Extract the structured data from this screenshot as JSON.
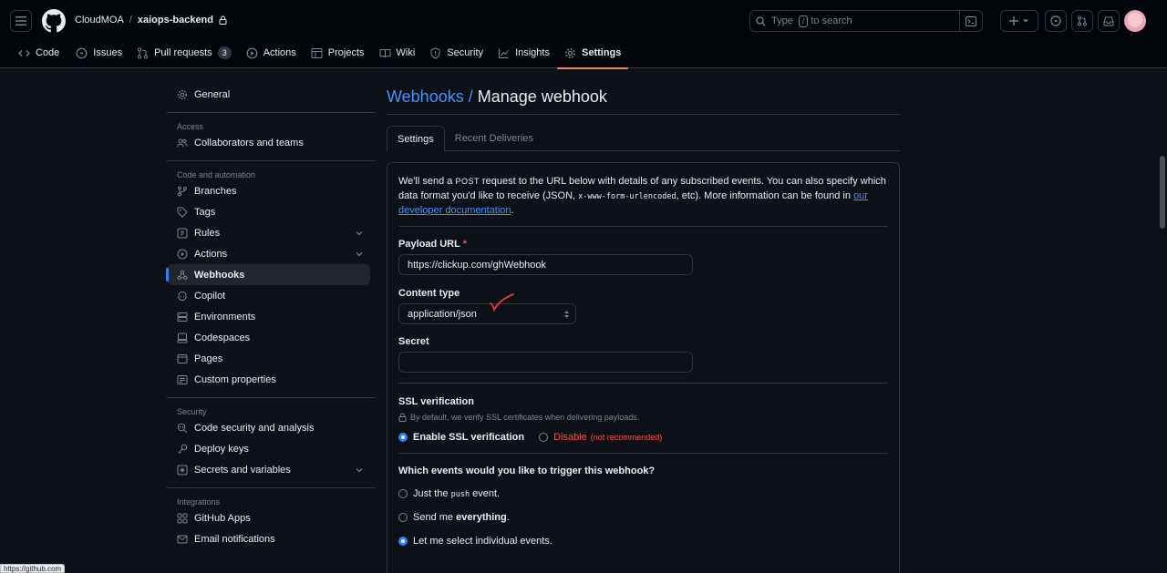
{
  "header": {
    "owner": "CloudMOA",
    "separator": "/",
    "repo": "xaiops-backend",
    "search_prefix": "Type",
    "search_key": "/",
    "search_suffix": "to search"
  },
  "repo_tabs": [
    {
      "label": "Code",
      "icon": "code-icon"
    },
    {
      "label": "Issues",
      "icon": "issue-icon"
    },
    {
      "label": "Pull requests",
      "icon": "pull-request-icon",
      "count": "3"
    },
    {
      "label": "Actions",
      "icon": "play-icon"
    },
    {
      "label": "Projects",
      "icon": "table-icon"
    },
    {
      "label": "Wiki",
      "icon": "book-icon"
    },
    {
      "label": "Security",
      "icon": "shield-icon"
    },
    {
      "label": "Insights",
      "icon": "graph-icon"
    },
    {
      "label": "Settings",
      "icon": "gear-icon",
      "active": true
    }
  ],
  "sidebar": {
    "general": "General",
    "access_heading": "Access",
    "collaborators": "Collaborators and teams",
    "code_heading": "Code and automation",
    "branches": "Branches",
    "tags": "Tags",
    "rules": "Rules",
    "actions": "Actions",
    "webhooks": "Webhooks",
    "copilot": "Copilot",
    "environments": "Environments",
    "codespaces": "Codespaces",
    "pages": "Pages",
    "custom_properties": "Custom properties",
    "security_heading": "Security",
    "code_security": "Code security and analysis",
    "deploy_keys": "Deploy keys",
    "secrets": "Secrets and variables",
    "integrations_heading": "Integrations",
    "github_apps": "GitHub Apps",
    "email_notifications": "Email notifications"
  },
  "main": {
    "title_link": "Webhooks",
    "title_sep": "/",
    "title_rest": "Manage webhook",
    "tab_settings": "Settings",
    "tab_deliveries": "Recent Deliveries",
    "intro_1": "We'll send a",
    "intro_post": "POST",
    "intro_2": "request to the URL below with details of any subscribed events. You can also specify which data format you'd like to receive (JSON,",
    "intro_code": "x-www-form-urlencoded",
    "intro_3": ", etc). More information can be found in",
    "intro_link": "our developer documentation",
    "intro_end": ".",
    "payload_label": "Payload URL",
    "required_mark": "*",
    "payload_value": "https://clickup.com/ghWebhook",
    "content_type_label": "Content type",
    "content_type_value": "application/json",
    "secret_label": "Secret",
    "secret_value": "",
    "ssl_label": "SSL verification",
    "ssl_hint": "By default, we verify SSL certificates when delivering payloads.",
    "ssl_enable": "Enable SSL verification",
    "ssl_disable": "Disable",
    "ssl_disable_note": "(not recommended)",
    "events_label": "Which events would you like to trigger this webhook?",
    "event_push_1": "Just the",
    "event_push_code": "push",
    "event_push_2": "event.",
    "event_all_1": "Send me",
    "event_all_bold": "everything",
    "event_all_2": ".",
    "event_select": "Let me select individual events."
  },
  "status_url": "https://github.com"
}
